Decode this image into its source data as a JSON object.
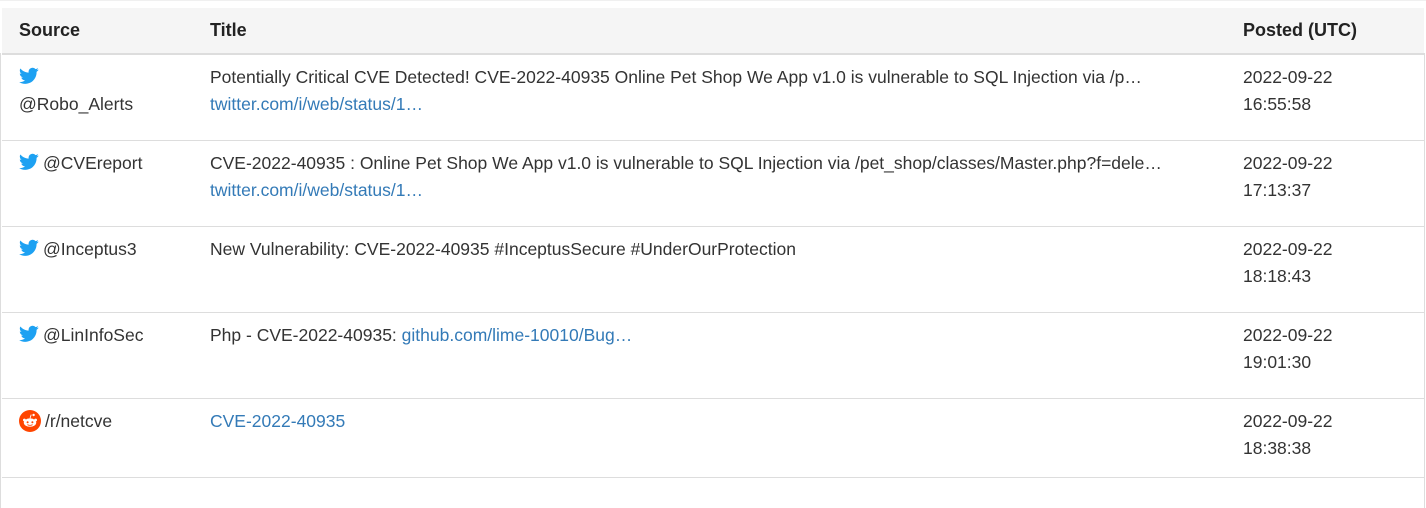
{
  "table": {
    "headers": {
      "source": "Source",
      "title": "Title",
      "posted": "Posted (UTC)"
    },
    "rows": [
      {
        "source_icon": "twitter-icon",
        "source": "@Robo_Alerts",
        "title_text": "Potentially Critical CVE Detected! CVE-2022-40935 Online Pet Shop We App v1.0 is vulnerable to SQL Injection via /p…",
        "link_text": "twitter.com/i/web/status/1…",
        "date": "2022-09-22",
        "time": "16:55:58"
      },
      {
        "source_icon": "twitter-icon",
        "source": "@CVEreport",
        "title_text": "CVE-2022-40935 : Online Pet Shop We App v1.0 is vulnerable to SQL Injection via /pet_shop/classes/Master.php?f=dele…",
        "link_text": "twitter.com/i/web/status/1…",
        "date": "2022-09-22",
        "time": "17:13:37"
      },
      {
        "source_icon": "twitter-icon",
        "source": "@Inceptus3",
        "title_text": "New Vulnerability: CVE-2022-40935 #InceptusSecure #UnderOurProtection",
        "link_text": "",
        "date": "2022-09-22",
        "time": "18:18:43"
      },
      {
        "source_icon": "twitter-icon",
        "source": "@LinInfoSec",
        "title_text": "Php - CVE-2022-40935:",
        "link_text": "github.com/lime-10010/Bug…",
        "date": "2022-09-22",
        "time": "19:01:30"
      },
      {
        "source_icon": "reddit-icon",
        "source": "/r/netcve",
        "title_text": "",
        "link_text": "CVE-2022-40935",
        "date": "2022-09-22",
        "time": "18:38:38"
      }
    ]
  },
  "colors": {
    "link": "#337ab7",
    "twitter": "#1da1f2",
    "reddit": "#ff4500",
    "header_bg": "#f5f5f5",
    "border": "#dddddd"
  }
}
